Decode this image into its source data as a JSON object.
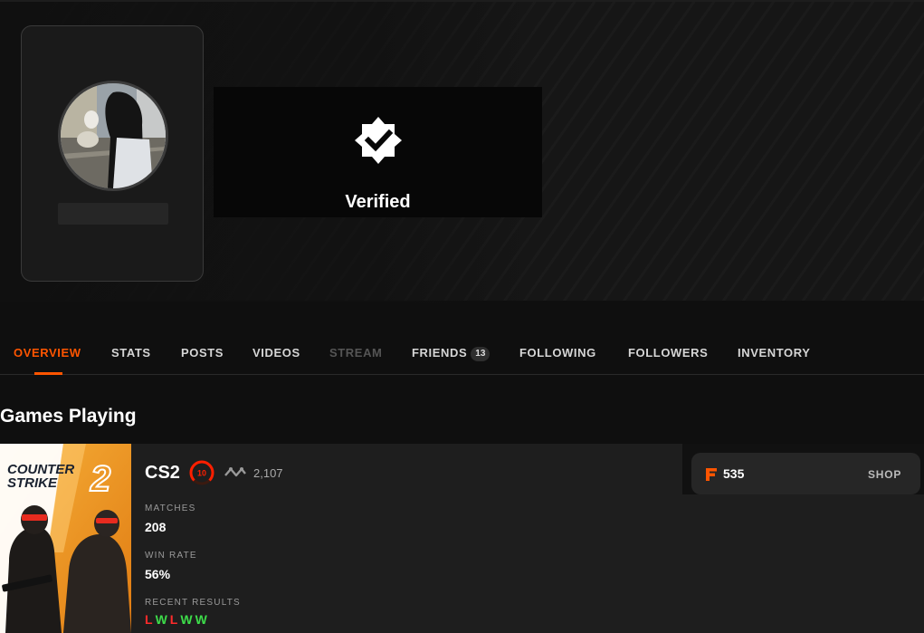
{
  "profile": {
    "verified_label": "Verified"
  },
  "tabs": [
    {
      "label": "OVERVIEW",
      "state": "active"
    },
    {
      "label": "STATS",
      "state": "normal"
    },
    {
      "label": "POSTS",
      "state": "normal"
    },
    {
      "label": "VIDEOS",
      "state": "normal"
    },
    {
      "label": "STREAM",
      "state": "disabled"
    },
    {
      "label": "FRIENDS",
      "state": "normal",
      "badge": "13"
    },
    {
      "label": "FOLLOWING",
      "state": "normal"
    },
    {
      "label": "FOLLOWERS",
      "state": "normal"
    },
    {
      "label": "INVENTORY",
      "state": "normal"
    }
  ],
  "games_section": {
    "title": "Games Playing"
  },
  "game": {
    "cover_title_line1": "COUNTER",
    "cover_title_line2": "STRIKE",
    "cover_number": "2",
    "name": "CS2",
    "level": "10",
    "elo": "2,107",
    "stats": [
      {
        "label": "MATCHES",
        "value": "208"
      },
      {
        "label": "WIN RATE",
        "value": "56%"
      }
    ],
    "recent_results_label": "RECENT RESULTS",
    "recent_results": [
      "L",
      "W",
      "L",
      "W",
      "W"
    ]
  },
  "shop": {
    "points": "535",
    "button_label": "SHOP"
  },
  "colors": {
    "accent": "#ff5500",
    "win": "#3ddc4a",
    "loss": "#ff2b2b"
  }
}
